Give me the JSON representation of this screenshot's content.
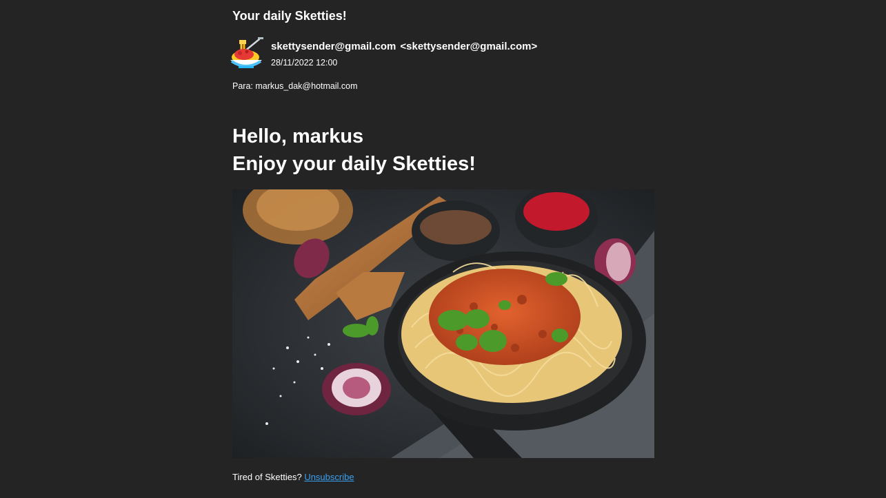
{
  "subject": "Your daily Sketties!",
  "sender": {
    "name": "skettysender@gmail.com",
    "address": "<skettysender@gmail.com>",
    "date": "28/11/2022 12:00",
    "avatar_icon": "spaghetti-plate-icon"
  },
  "recipient": "Para: markus_dak@hotmail.com",
  "body": {
    "greeting_line1": "Hello, markus",
    "greeting_line2": "Enjoy your daily Sketties!",
    "image_icon": "spaghetti-bolognese-photo"
  },
  "footer": {
    "prompt": "Tired of Sketties?",
    "unsubscribe_label": "Unsubscribe"
  },
  "colors": {
    "background": "#242424",
    "text": "#ffffff",
    "link": "#3aa0f0"
  }
}
